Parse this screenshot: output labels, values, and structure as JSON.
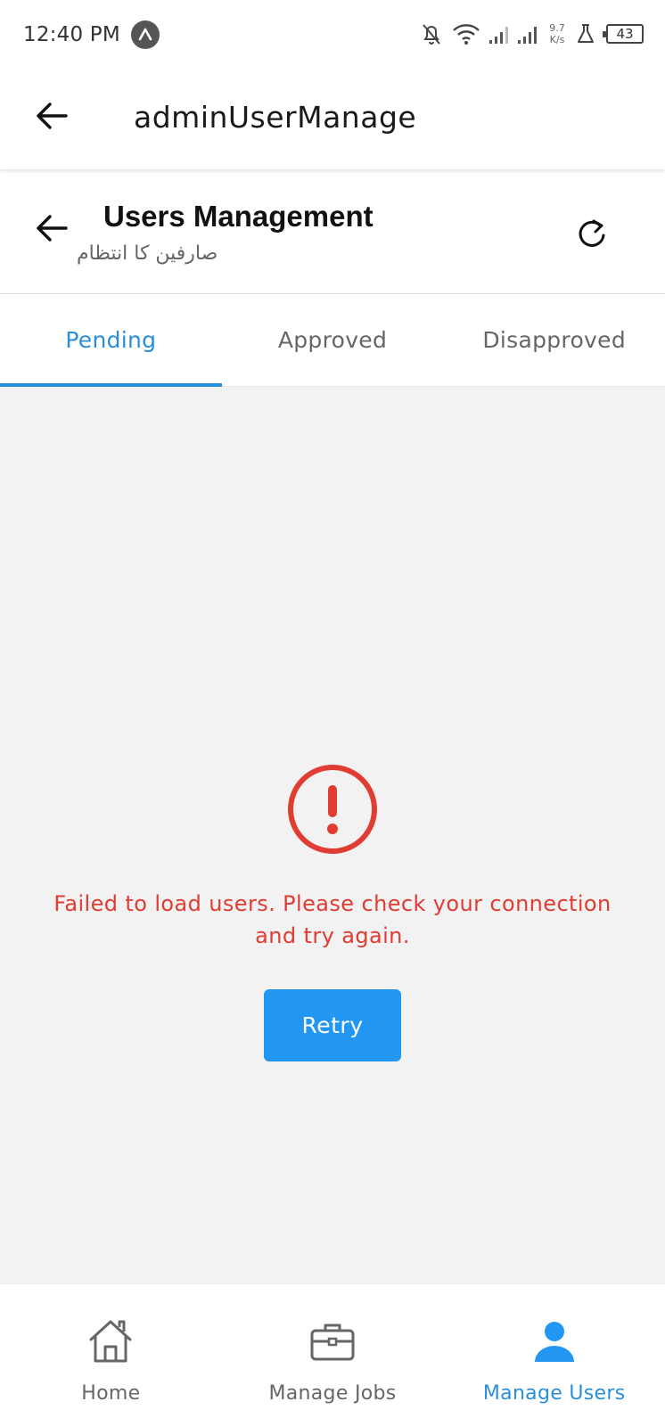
{
  "status_bar": {
    "time": "12:40 PM",
    "net_speed_value": "9.7",
    "net_speed_unit": "K/s",
    "battery": "43"
  },
  "app_bar": {
    "title": "adminUserManage"
  },
  "page_header": {
    "title": "Users Management",
    "subtitle": "صارفین کا انتظام"
  },
  "tabs": [
    {
      "label": "Pending",
      "active": true
    },
    {
      "label": "Approved",
      "active": false
    },
    {
      "label": "Disapproved",
      "active": false
    }
  ],
  "error": {
    "message_line1": "Failed to load users. Please check your connection",
    "message_line2": "and try again.",
    "retry_label": "Retry",
    "color": "#e03c31"
  },
  "bottom_nav": [
    {
      "label": "Home",
      "icon": "home-icon",
      "active": false
    },
    {
      "label": "Manage Jobs",
      "icon": "briefcase-icon",
      "active": false
    },
    {
      "label": "Manage Users",
      "icon": "user-icon",
      "active": true
    }
  ],
  "colors": {
    "accent": "#2b8fd8",
    "button": "#2196f3",
    "background": "#f2f2f2"
  }
}
